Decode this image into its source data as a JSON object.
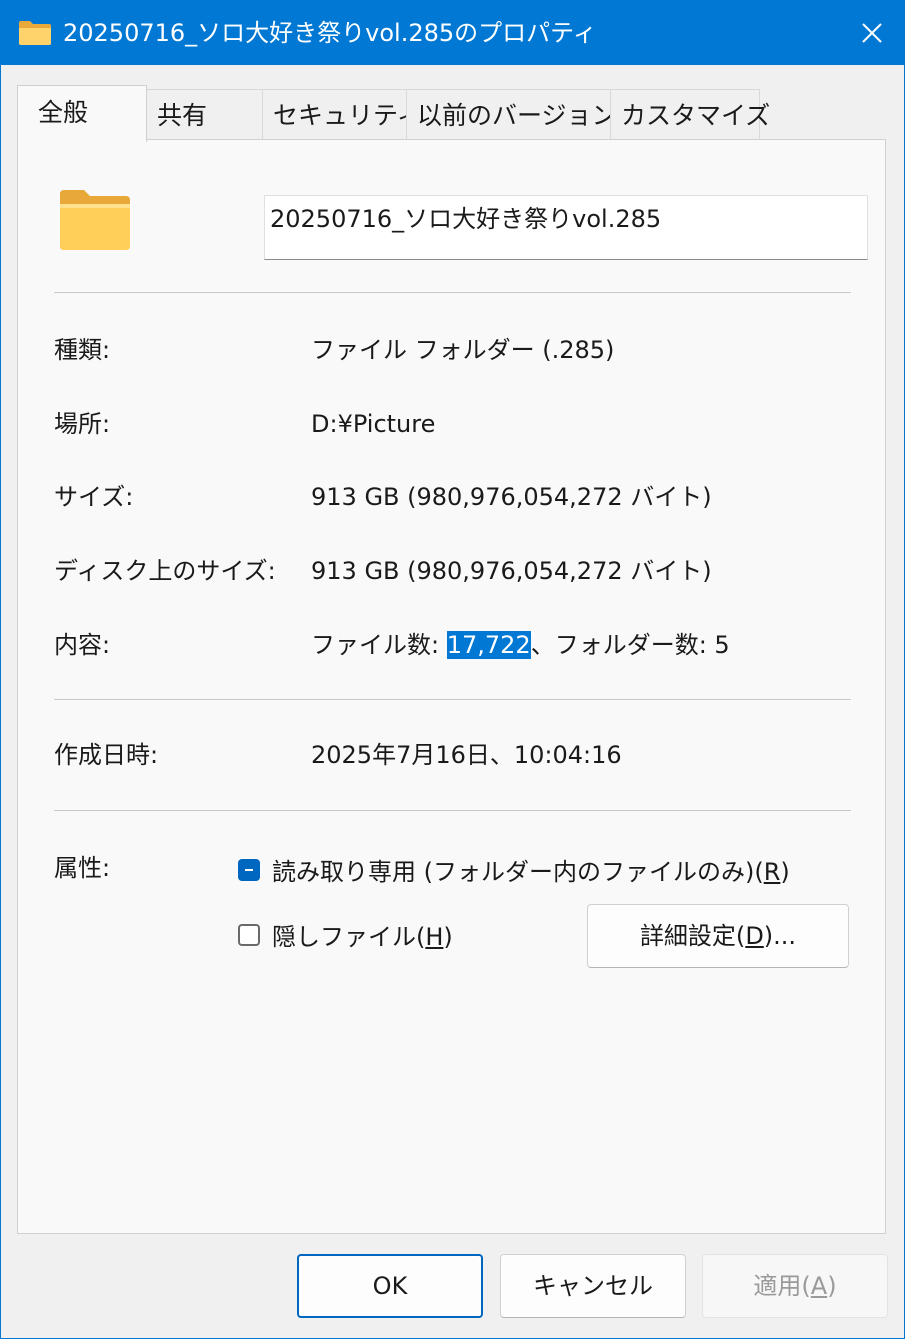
{
  "window": {
    "title": "20250716_ソロ大好き祭りvol.285のプロパティ"
  },
  "tabs": [
    {
      "label": "全般",
      "active": true
    },
    {
      "label": "共有"
    },
    {
      "label": "セキュリティ"
    },
    {
      "label": "以前のバージョン"
    },
    {
      "label": "カスタマイズ"
    }
  ],
  "general": {
    "folder_name": "20250716_ソロ大好き祭りvol.285",
    "type_label": "種類:",
    "type_value": "ファイル フォルダー (.285)",
    "location_label": "場所:",
    "location_value": "D:¥Picture",
    "size_label": "サイズ:",
    "size_value": "913 GB (980,976,054,272 バイト)",
    "size_on_disk_label": "ディスク上のサイズ:",
    "size_on_disk_value": "913 GB (980,976,054,272 バイト)",
    "contents_label": "内容:",
    "contents_prefix": "ファイル数: ",
    "contents_files": "17,722",
    "contents_suffix": "、フォルダー数: 5",
    "created_label": "作成日時:",
    "created_value": "2025年7月16日、10:04:16",
    "attributes_label": "属性:",
    "readonly_label": "読み取り専用 (フォルダー内のファイルのみ)(",
    "readonly_key": "R",
    "readonly_state": "indeterminate",
    "hidden_label": "隠しファイル(",
    "hidden_key": "H",
    "hidden_state": "unchecked",
    "advanced_label": "詳細設定(",
    "advanced_key": "D",
    "advanced_suffix": ")..."
  },
  "buttons": {
    "ok": "OK",
    "cancel": "キャンセル",
    "apply_label": "適用(",
    "apply_key": "A",
    "close_paren": ")"
  },
  "colors": {
    "accent": "#0078d4",
    "selection": "#0078d4"
  }
}
